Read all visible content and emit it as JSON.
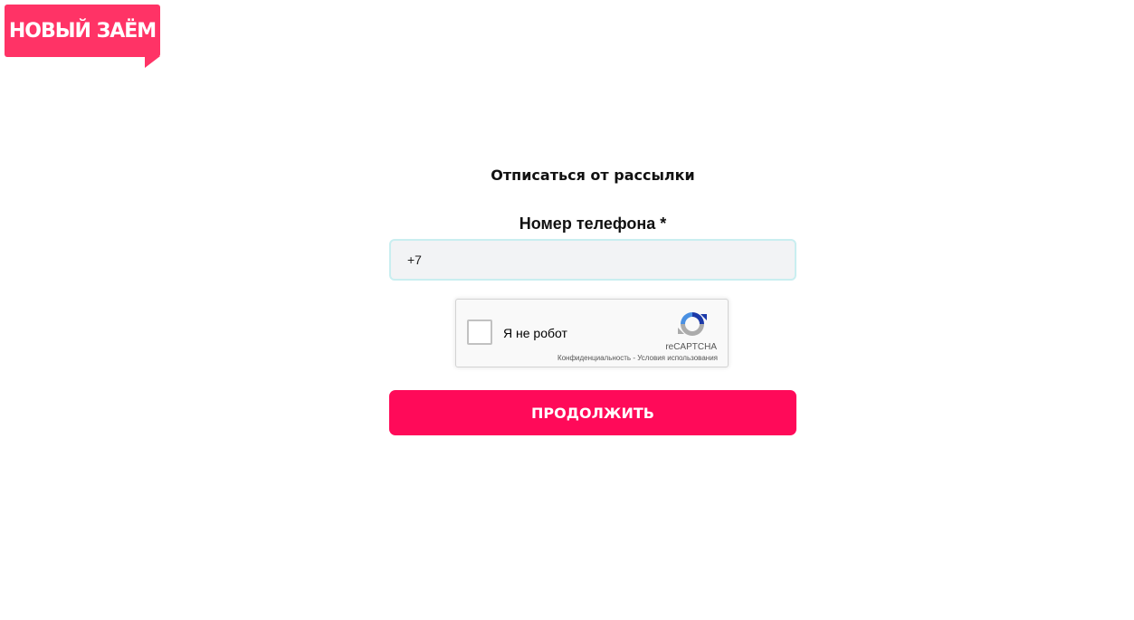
{
  "logo": {
    "text": "НОВЫЙ ЗАЁМ",
    "color": "#ff3366"
  },
  "form": {
    "title": "Отписаться от рассылки",
    "phone_label": "Номер телефона *",
    "phone_value": "+7",
    "submit_label": "ПРОДОЛЖИТЬ",
    "submit_color": "#ff0a59"
  },
  "recaptcha": {
    "checkbox_label": "Я не робот",
    "brand": "reCAPTCHA",
    "privacy_link": "Конфиденциальность",
    "separator": " - ",
    "terms_link": "Условия использования",
    "icon": "recaptcha-logo-icon"
  }
}
